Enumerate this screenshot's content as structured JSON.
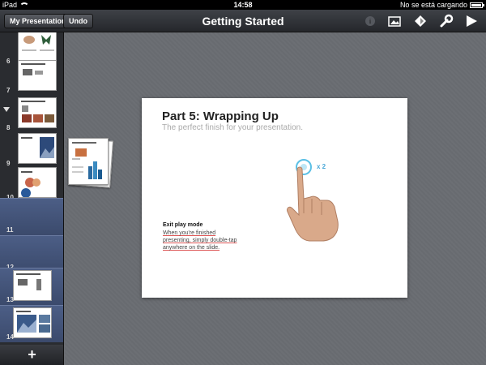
{
  "status_bar": {
    "device": "iPad",
    "time": "14:58",
    "loading_text": "No se está cargando"
  },
  "toolbar": {
    "presentations_label": "My Presentations",
    "undo_label": "Undo",
    "title": "Getting Started"
  },
  "sidebar": {
    "slides": [
      {
        "number": "6"
      },
      {
        "number": "7"
      },
      {
        "number": "8"
      },
      {
        "number": "9"
      },
      {
        "number": "10"
      },
      {
        "number": "11"
      },
      {
        "number": "12"
      },
      {
        "number": "13"
      },
      {
        "number": "14"
      }
    ],
    "add_label": "+"
  },
  "slide": {
    "title": "Part 5: Wrapping Up",
    "subtitle": "The perfect finish for your presentation.",
    "tap_count": "x 2",
    "exit_heading": "Exit play mode",
    "exit_body": "When you're finished presenting, simply double-tap anywhere on the slide."
  }
}
